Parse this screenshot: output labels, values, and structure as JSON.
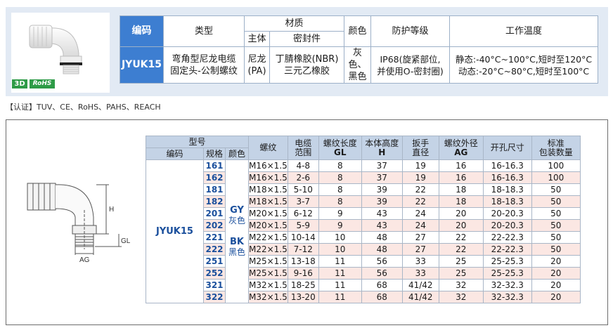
{
  "badges": {
    "three_d": "3D",
    "rohs": "RoHS"
  },
  "spec_table": {
    "headers": {
      "code": "编码",
      "type": "类型",
      "material": "材质",
      "material_body": "主体",
      "material_seal": "密封件",
      "color": "颜色",
      "protection": "防护等级",
      "temperature": "工作温度"
    },
    "row": {
      "code": "JYUK15",
      "type_line1": "弯角型尼龙电缆",
      "type_line2": "固定头-公制螺纹",
      "body_line1": "尼龙",
      "body_line2": "(PA)",
      "seal_line1": "丁腈橡胶(NBR)",
      "seal_line2": "三元乙橡胶",
      "color_line1": "灰色、",
      "color_line2": "黑色",
      "protection_line1": "IP68(旋紧部位,",
      "protection_line2": "并使用O-密封圈)",
      "temp_line1": "静态:-40°C~100°C,短时至120°C",
      "temp_line2": "动态:-20°C~80°C,短时至100°C"
    }
  },
  "certification": "【认证】TUV、CE、RoHS、PAHS、REACH",
  "drawing_labels": {
    "h": "H",
    "gl": "GL",
    "ag": "AG"
  },
  "dim_table": {
    "headers": {
      "model": "型号",
      "code": "编码",
      "spec": "规格",
      "color": "颜色",
      "thread": "螺纹",
      "cable_range_line1": "电缆",
      "cable_range_line2": "范围",
      "thread_length_line1": "螺纹长度",
      "thread_length_line2": "GL",
      "body_height_line1": "本体高度",
      "body_height_line2": "H",
      "wrench_line1": "扳手",
      "wrench_line2": "直径",
      "thread_od_line1": "螺纹外径",
      "thread_od_line2": "AG",
      "hole_size": "开孔尺寸",
      "package_line1": "标准",
      "package_line2": "包装数量"
    },
    "model_code": "JYUK15",
    "colors": {
      "gy_code": "GY",
      "gy_name": "灰色",
      "bk_code": "BK",
      "bk_name": "黑色"
    },
    "rows": [
      {
        "spec": "161",
        "thread": "M16×1.5",
        "range": "4-8",
        "gl": "8",
        "h": "37",
        "wrench": "19",
        "ag": "16",
        "hole": "16-16.3",
        "pack": "100"
      },
      {
        "spec": "162",
        "thread": "M16×1.5",
        "range": "2-6",
        "gl": "8",
        "h": "37",
        "wrench": "19",
        "ag": "16",
        "hole": "16-16.3",
        "pack": "100"
      },
      {
        "spec": "181",
        "thread": "M18×1.5",
        "range": "5-10",
        "gl": "8",
        "h": "39",
        "wrench": "22",
        "ag": "18",
        "hole": "18-18.3",
        "pack": "50"
      },
      {
        "spec": "182",
        "thread": "M18×1.5",
        "range": "3-7",
        "gl": "8",
        "h": "39",
        "wrench": "22",
        "ag": "18",
        "hole": "18-18.3",
        "pack": "50"
      },
      {
        "spec": "201",
        "thread": "M20×1.5",
        "range": "6-12",
        "gl": "9",
        "h": "43",
        "wrench": "24",
        "ag": "20",
        "hole": "20-20.3",
        "pack": "50"
      },
      {
        "spec": "202",
        "thread": "M20×1.5",
        "range": "5-9",
        "gl": "9",
        "h": "43",
        "wrench": "24",
        "ag": "20",
        "hole": "20-20.3",
        "pack": "50"
      },
      {
        "spec": "221",
        "thread": "M22×1.5",
        "range": "10-14",
        "gl": "10",
        "h": "48",
        "wrench": "27",
        "ag": "22",
        "hole": "22-22.3",
        "pack": "50"
      },
      {
        "spec": "222",
        "thread": "M22×1.5",
        "range": "7-12",
        "gl": "10",
        "h": "48",
        "wrench": "27",
        "ag": "22",
        "hole": "22-22.3",
        "pack": "50"
      },
      {
        "spec": "251",
        "thread": "M25×1.5",
        "range": "13-18",
        "gl": "11",
        "h": "56",
        "wrench": "33",
        "ag": "25",
        "hole": "25-25.3",
        "pack": "20"
      },
      {
        "spec": "252",
        "thread": "M25×1.5",
        "range": "9-16",
        "gl": "11",
        "h": "56",
        "wrench": "33",
        "ag": "25",
        "hole": "25-25.3",
        "pack": "20"
      },
      {
        "spec": "321",
        "thread": "M32×1.5",
        "range": "18-25",
        "gl": "11",
        "h": "68",
        "wrench": "41/42",
        "ag": "32",
        "hole": "32-32.3",
        "pack": "20"
      },
      {
        "spec": "322",
        "thread": "M32×1.5",
        "range": "13-20",
        "gl": "11",
        "h": "68",
        "wrench": "41/42",
        "ag": "32",
        "hole": "32-32.3",
        "pack": "20"
      }
    ]
  }
}
